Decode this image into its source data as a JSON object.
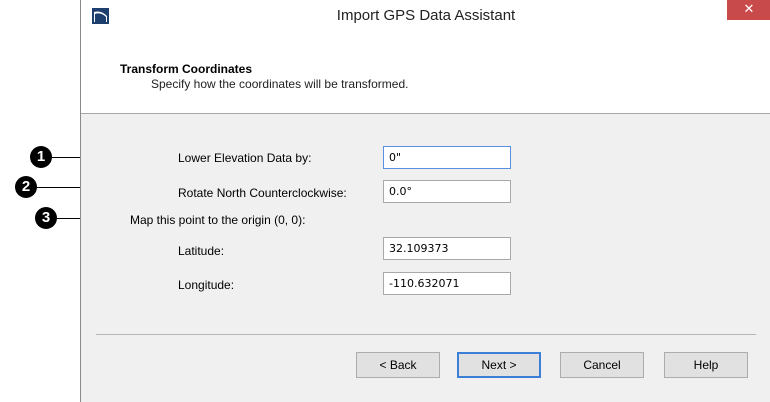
{
  "window": {
    "title": "Import GPS Data Assistant",
    "close_glyph": "✕"
  },
  "header": {
    "title": "Transform Coordinates",
    "subtitle": "Specify how the coordinates will be transformed."
  },
  "form": {
    "elevation_label": "Lower Elevation Data by:",
    "elevation_value": "0\"",
    "rotate_label": "Rotate North Counterclockwise:",
    "rotate_value": "0.0°",
    "origin_label": "Map this point to the origin (0, 0):",
    "latitude_label": "Latitude:",
    "latitude_value": "32.109373",
    "longitude_label": "Longitude:",
    "longitude_value": "-110.632071"
  },
  "buttons": {
    "back": "< Back",
    "next": "Next >",
    "cancel": "Cancel",
    "help": "Help"
  },
  "callouts": [
    "1",
    "2",
    "3"
  ],
  "colors": {
    "close_button": "#c94a4a",
    "focus_border": "#5a8ee0",
    "app_icon": "#1c3f6e"
  },
  "icons": {
    "app": "app-logo-icon",
    "close": "close-icon"
  }
}
